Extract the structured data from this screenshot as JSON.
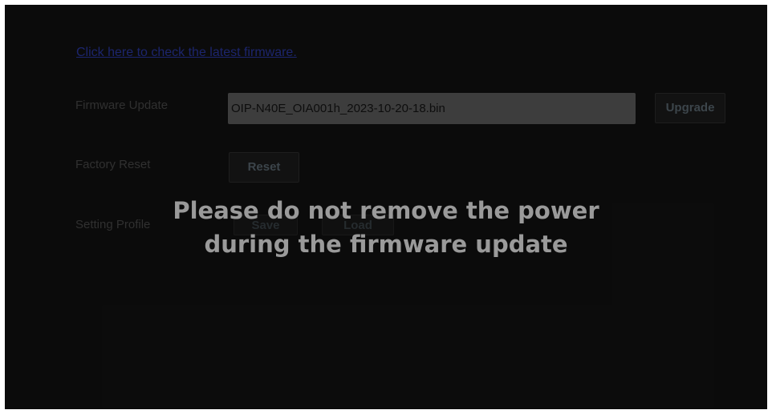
{
  "firmware_link": "Click here to check the latest firmware.",
  "firmware_update": {
    "label": "Firmware Update",
    "file_value": "OIP-N40E_OIA001h_2023-10-20-18.bin",
    "upgrade_label": "Upgrade"
  },
  "factory_reset": {
    "label": "Factory Reset",
    "reset_label": "Reset"
  },
  "setting_profile": {
    "label": "Setting Profile",
    "save_label": "Save",
    "load_label": "Load"
  },
  "overlay": {
    "line1": "Please do not remove the power",
    "line2": "during the firmware update"
  }
}
